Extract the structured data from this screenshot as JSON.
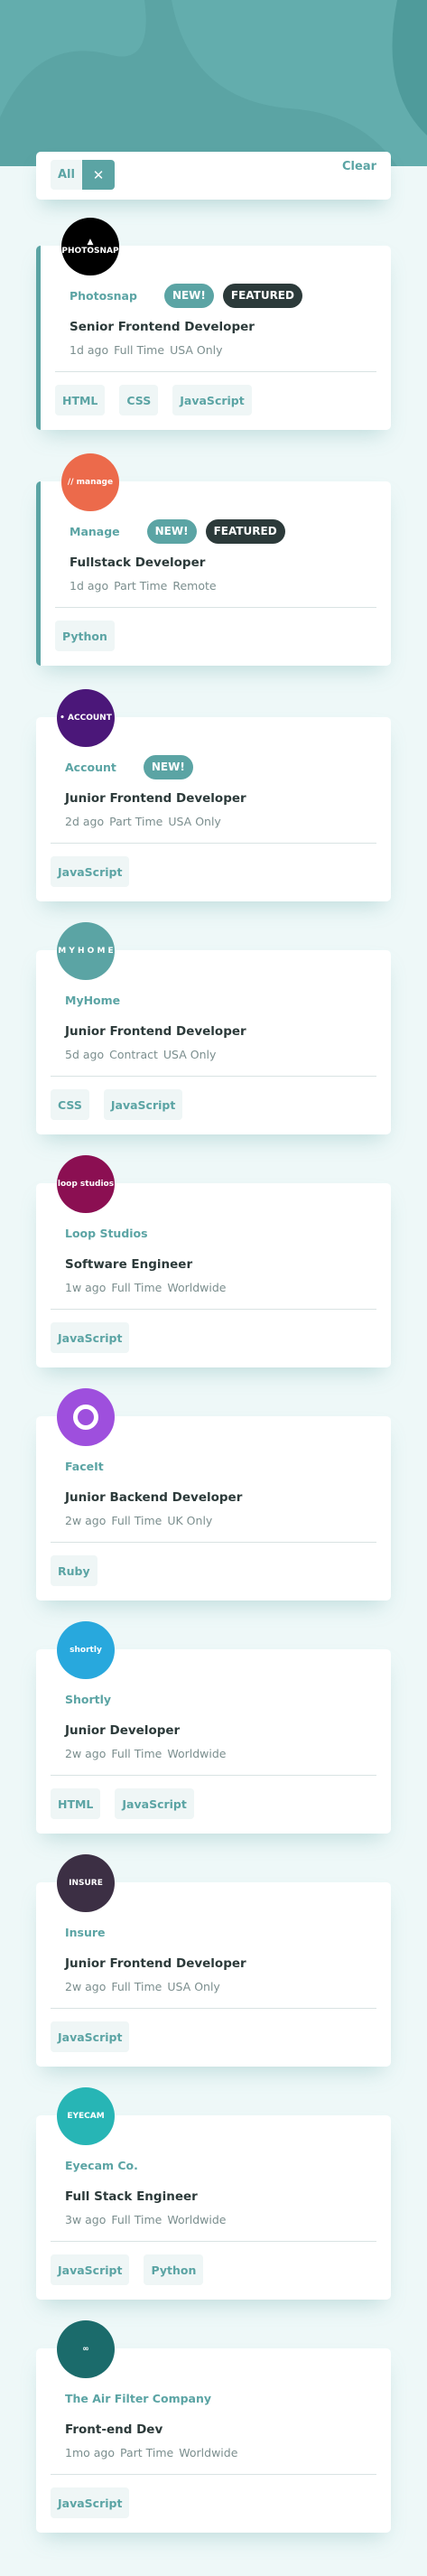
{
  "filter": {
    "active_tag": "All",
    "remove_glyph": "✕",
    "clear_label": "Clear"
  },
  "jobs": [
    {
      "company": "Photosnap",
      "logo_text": "▲ PHOTOSNAP",
      "logo_color": "#000000",
      "new": "NEW!",
      "featured": "FEATURED",
      "position": "Senior Frontend Developer",
      "posted": "1d ago",
      "contract": "Full Time",
      "location": "USA Only",
      "tags": [
        "HTML",
        "CSS",
        "JavaScript"
      ]
    },
    {
      "company": "Manage",
      "logo_text": "// manage",
      "logo_color": "#ec6a4b",
      "new": "NEW!",
      "featured": "FEATURED",
      "position": "Fullstack Developer",
      "posted": "1d ago",
      "contract": "Part Time",
      "location": "Remote",
      "tags": [
        "Python"
      ]
    },
    {
      "company": "Account",
      "logo_text": "• ACCOUNT",
      "logo_color": "#4b1779",
      "new": "NEW!",
      "featured": null,
      "position": "Junior Frontend Developer",
      "posted": "2d ago",
      "contract": "Part Time",
      "location": "USA Only",
      "tags": [
        "JavaScript"
      ]
    },
    {
      "company": "MyHome",
      "logo_text": "M Y H O M E",
      "logo_color": "#5ba4a4",
      "new": null,
      "featured": null,
      "position": "Junior Frontend Developer",
      "posted": "5d ago",
      "contract": "Contract",
      "location": "USA Only",
      "tags": [
        "CSS",
        "JavaScript"
      ]
    },
    {
      "company": "Loop Studios",
      "logo_text": "loop studios",
      "logo_color": "#8b0f52",
      "new": null,
      "featured": null,
      "position": "Software Engineer",
      "posted": "1w ago",
      "contract": "Full Time",
      "location": "Worldwide",
      "tags": [
        "JavaScript"
      ]
    },
    {
      "company": "FaceIt",
      "logo_text": "",
      "logo_color": "#9e4fdd",
      "new": null,
      "featured": null,
      "position": "Junior Backend Developer",
      "posted": "2w ago",
      "contract": "Full Time",
      "location": "UK Only",
      "tags": [
        "Ruby"
      ]
    },
    {
      "company": "Shortly",
      "logo_text": "shortly",
      "logo_color": "#28a8dd",
      "new": null,
      "featured": null,
      "position": "Junior Developer",
      "posted": "2w ago",
      "contract": "Full Time",
      "location": "Worldwide",
      "tags": [
        "HTML",
        "JavaScript"
      ]
    },
    {
      "company": "Insure",
      "logo_text": "INSURE",
      "logo_color": "#3c2f44",
      "new": null,
      "featured": null,
      "position": "Junior Frontend Developer",
      "posted": "2w ago",
      "contract": "Full Time",
      "location": "USA Only",
      "tags": [
        "JavaScript"
      ]
    },
    {
      "company": "Eyecam Co.",
      "logo_text": "EYECAM",
      "logo_color": "#27b5b5",
      "new": null,
      "featured": null,
      "position": "Full Stack Engineer",
      "posted": "3w ago",
      "contract": "Full Time",
      "location": "Worldwide",
      "tags": [
        "JavaScript",
        "Python"
      ]
    },
    {
      "company": "The Air Filter Company",
      "logo_text": "∞",
      "logo_color": "#1b6b6b",
      "new": null,
      "featured": null,
      "position": "Front-end Dev",
      "posted": "1mo ago",
      "contract": "Part Time",
      "location": "Worldwide",
      "tags": [
        "JavaScript"
      ]
    }
  ]
}
